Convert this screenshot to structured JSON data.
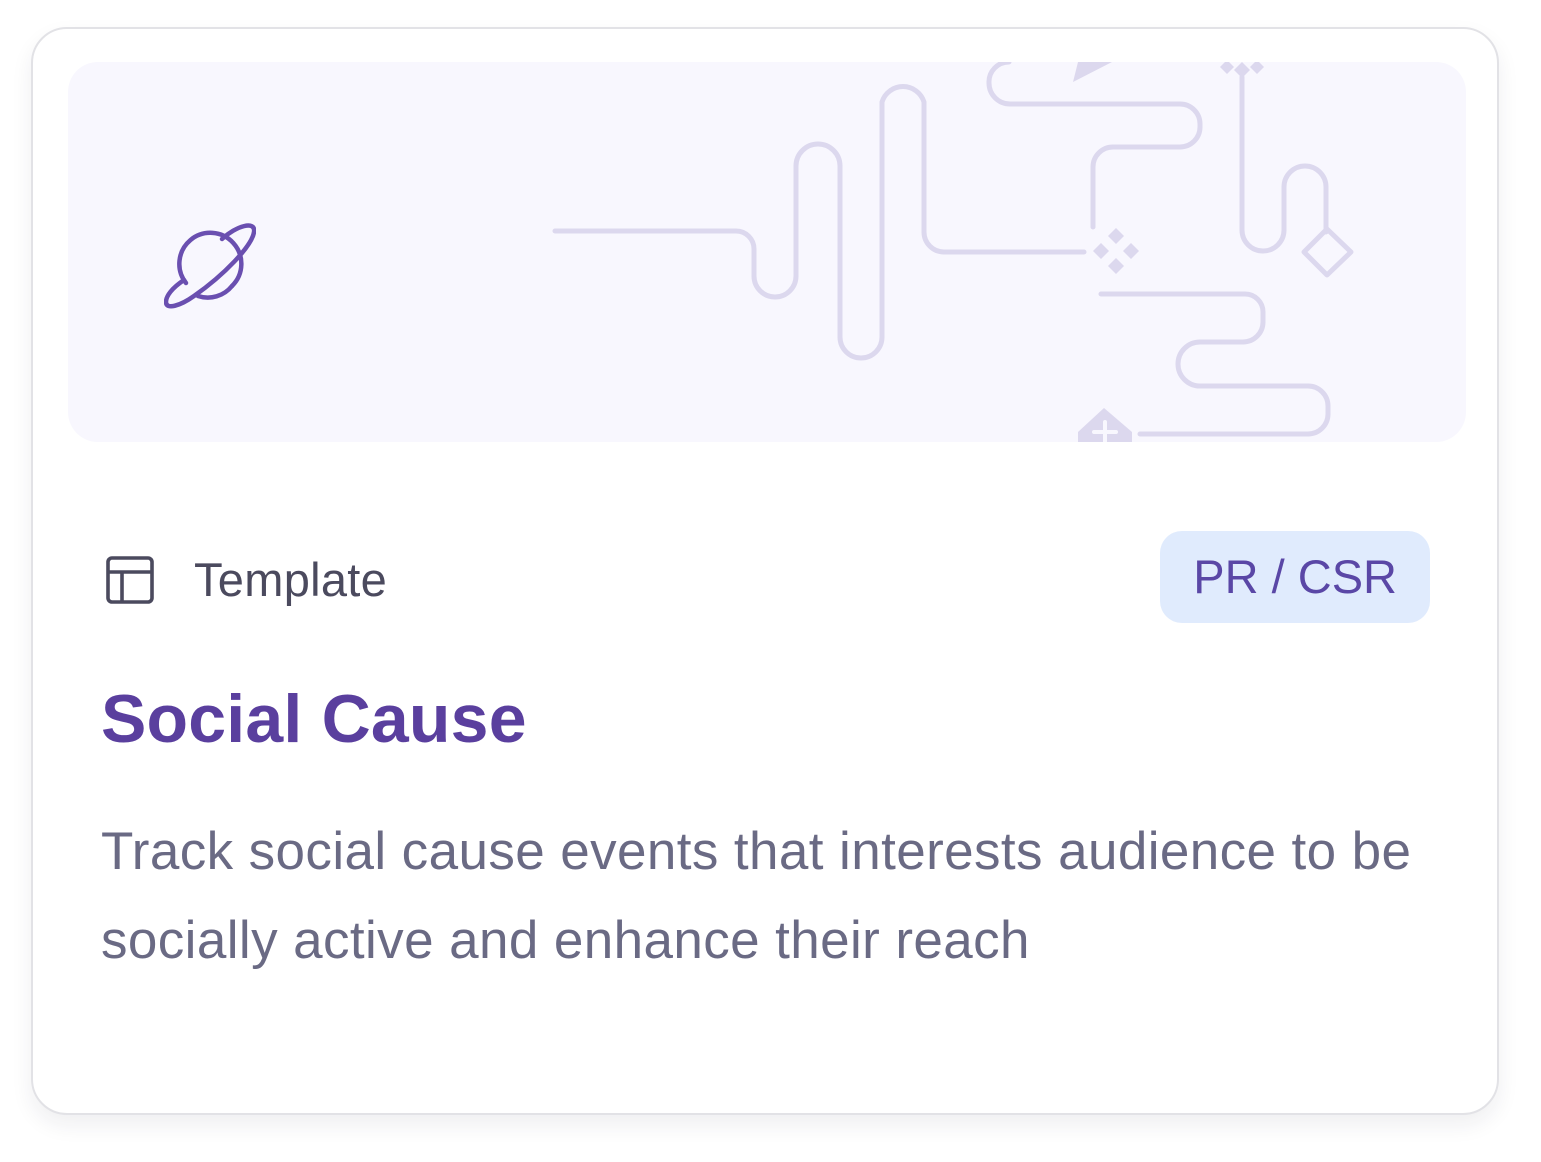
{
  "card": {
    "type_label": "Template",
    "category_badge": "PR / CSR",
    "title": "Social Cause",
    "description": "Track social cause events that interests audience to be socially active and enhance their reach"
  },
  "icons": {
    "hero": "planet-icon",
    "type": "template-layout-icon"
  },
  "colors": {
    "accent": "#5a3f9e",
    "badge_bg": "#e0ebfd",
    "badge_text": "#5a47a6",
    "banner_bg": "#f8f7fe",
    "decoration": "#dcd8ee"
  }
}
